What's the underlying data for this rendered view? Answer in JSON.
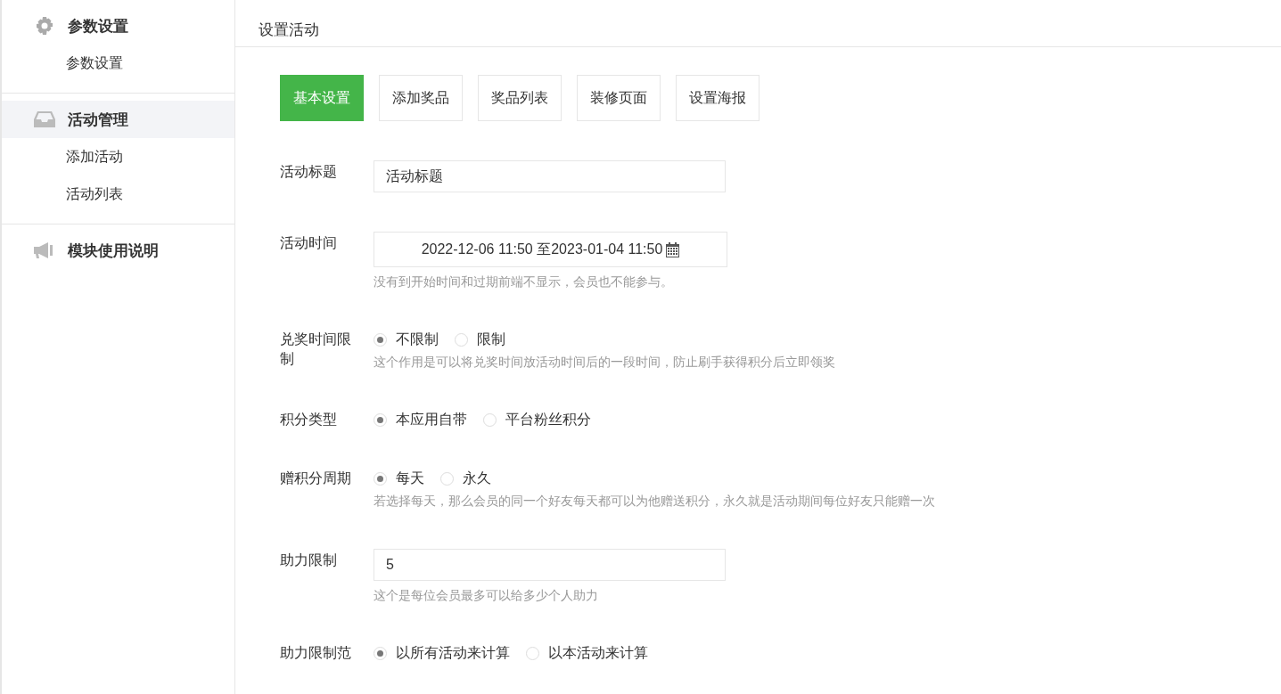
{
  "sidebar": {
    "groups": [
      {
        "title": "参数设置",
        "kind": "gear",
        "selected": false,
        "items": [
          {
            "label": "参数设置"
          }
        ]
      },
      {
        "title": "活动管理",
        "kind": "inbox",
        "selected": true,
        "items": [
          {
            "label": "添加活动"
          },
          {
            "label": "活动列表"
          }
        ]
      },
      {
        "title": "模块使用说明",
        "kind": "megaphone",
        "selected": false
      }
    ]
  },
  "page_title": "设置活动",
  "tabs": [
    {
      "label": "基本设置",
      "selected": true
    },
    {
      "label": "添加奖品",
      "selected": false
    },
    {
      "label": "奖品列表",
      "selected": false
    },
    {
      "label": "装修页面",
      "selected": false
    },
    {
      "label": "设置海报",
      "selected": false
    }
  ],
  "form": [
    {
      "kind": "text",
      "label": "活动标题",
      "value": "活动标题"
    },
    {
      "kind": "daterange",
      "label": "活动时间",
      "value": "2022-12-06 11:50 至2023-01-04 11:50",
      "hint": "没有到开始时间和过期前端不显示，会员也不能参与。"
    },
    {
      "kind": "radio",
      "label": "兑奖时间限制",
      "options": [
        {
          "label": "不限制",
          "selected": true
        },
        {
          "label": "限制",
          "selected": false
        }
      ],
      "hint": "这个作用是可以将兑奖时间放活动时间后的一段时间，防止刷手获得积分后立即领奖"
    },
    {
      "kind": "radio",
      "label": "积分类型",
      "options": [
        {
          "label": "本应用自带",
          "selected": true
        },
        {
          "label": "平台粉丝积分",
          "selected": false
        }
      ]
    },
    {
      "kind": "radio",
      "label": "赠积分周期",
      "options": [
        {
          "label": "每天",
          "selected": true
        },
        {
          "label": "永久",
          "selected": false
        }
      ],
      "hint": "若选择每天，那么会员的同一个好友每天都可以为他赠送积分，永久就是活动期间每位好友只能赠一次"
    },
    {
      "kind": "text",
      "label": "助力限制",
      "value": "5",
      "hint": "这个是每位会员最多可以给多少个人助力"
    },
    {
      "kind": "radio",
      "label": "助力限制范",
      "options": [
        {
          "label": "以所有活动来计算",
          "selected": true
        },
        {
          "label": "以本活动来计算",
          "selected": false
        }
      ]
    }
  ]
}
